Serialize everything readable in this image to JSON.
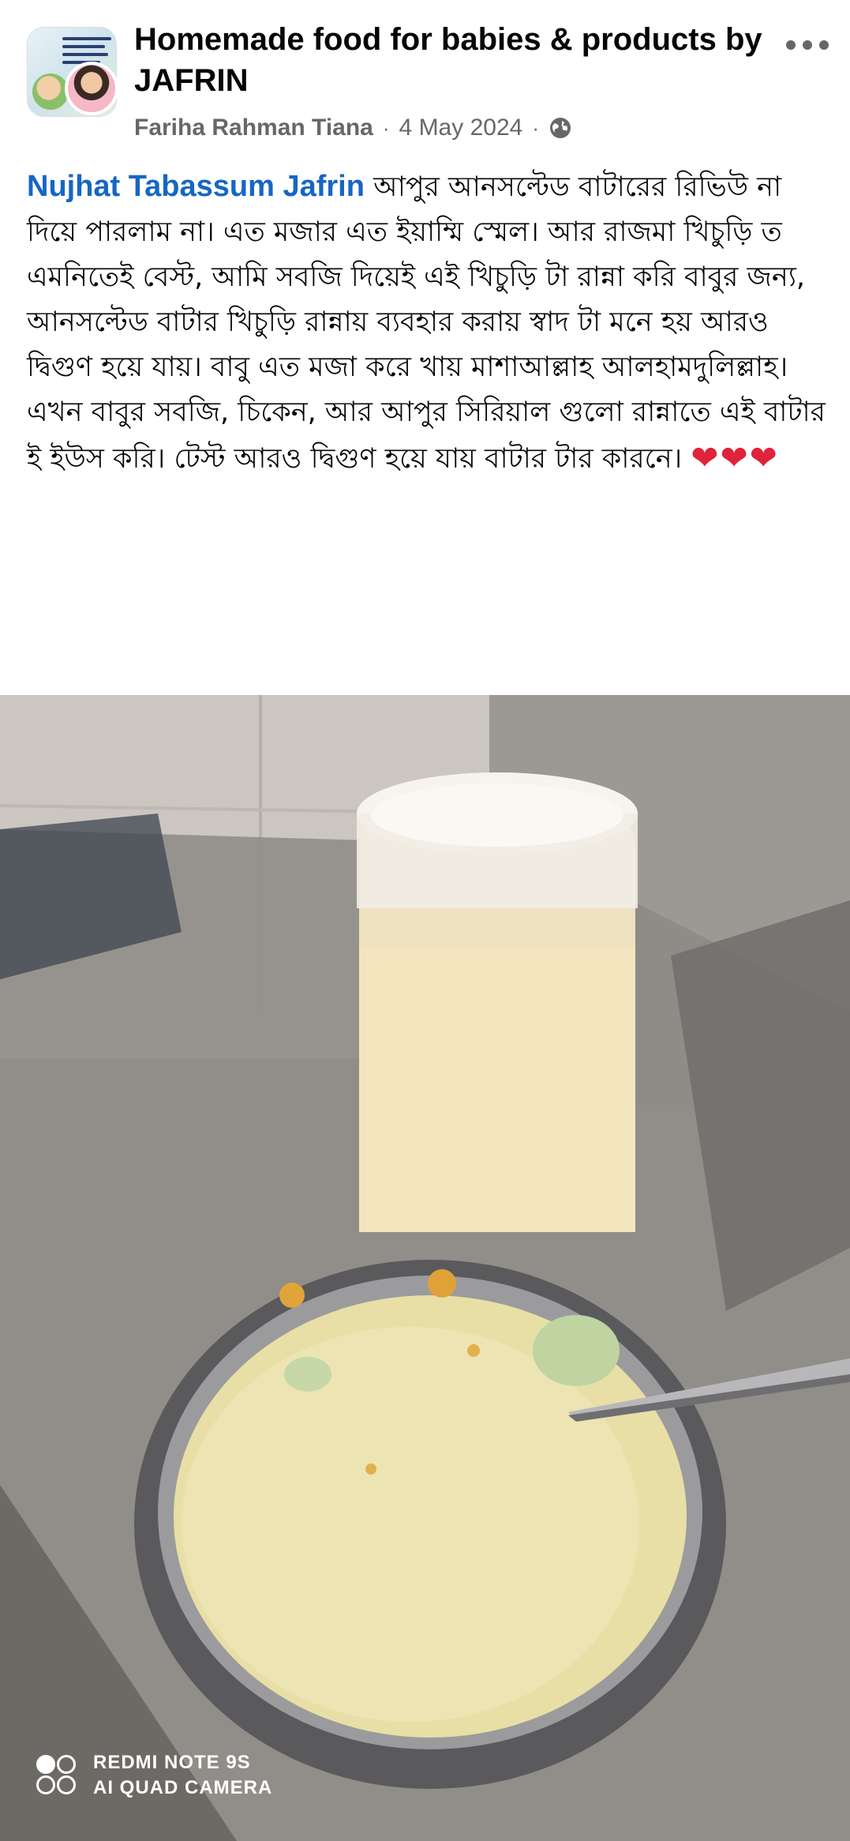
{
  "post": {
    "group_name": "Homemade food for babies & products by JAFRIN",
    "author": "Fariha Rahman Tiana",
    "separator": "·",
    "date": "4 May 2024",
    "audience_icon": "globe-icon",
    "more_icon": "more-horizontal-icon",
    "mention": "Nujhat Tabassum Jafrin",
    "text_1": " আপুর আনসল্টেড বাটারের রিভিউ না দিয়ে পারলাম না।  এত মজার এত ইয়াম্মি স্মেল। আর রাজমা খিচুড়ি ত এমনিতেই বেস্ট, আমি  সবজি দিয়েই এই খিচুড়ি টা রান্না করি বাবুর জন্য,  আনসল্টেড বাটার খিচুড়ি রান্নায় ব্যবহার করায় স্বাদ টা মনে হয় আরও দ্বিগুণ হয়ে যায়। বাবু  এত মজা করে খায় মাশাআল্লাহ আলহামদুলিল্লাহ।",
    "text_2": "এখন  বাবুর সবজি, চিকেন, আর আপুর সিরিয়াল গুলো রান্নাতে এই বাটার ই ইউস করি। টেস্ট আরও দ্বিগুণ হয়ে যায় বাটার টার কারনে।",
    "hearts": "❤❤❤",
    "mention_color": "#1766c4",
    "meta_color": "#65676b"
  },
  "photo": {
    "watermark_line1": "REDMI NOTE 9S",
    "watermark_line2": "AI QUAD CAMERA"
  }
}
